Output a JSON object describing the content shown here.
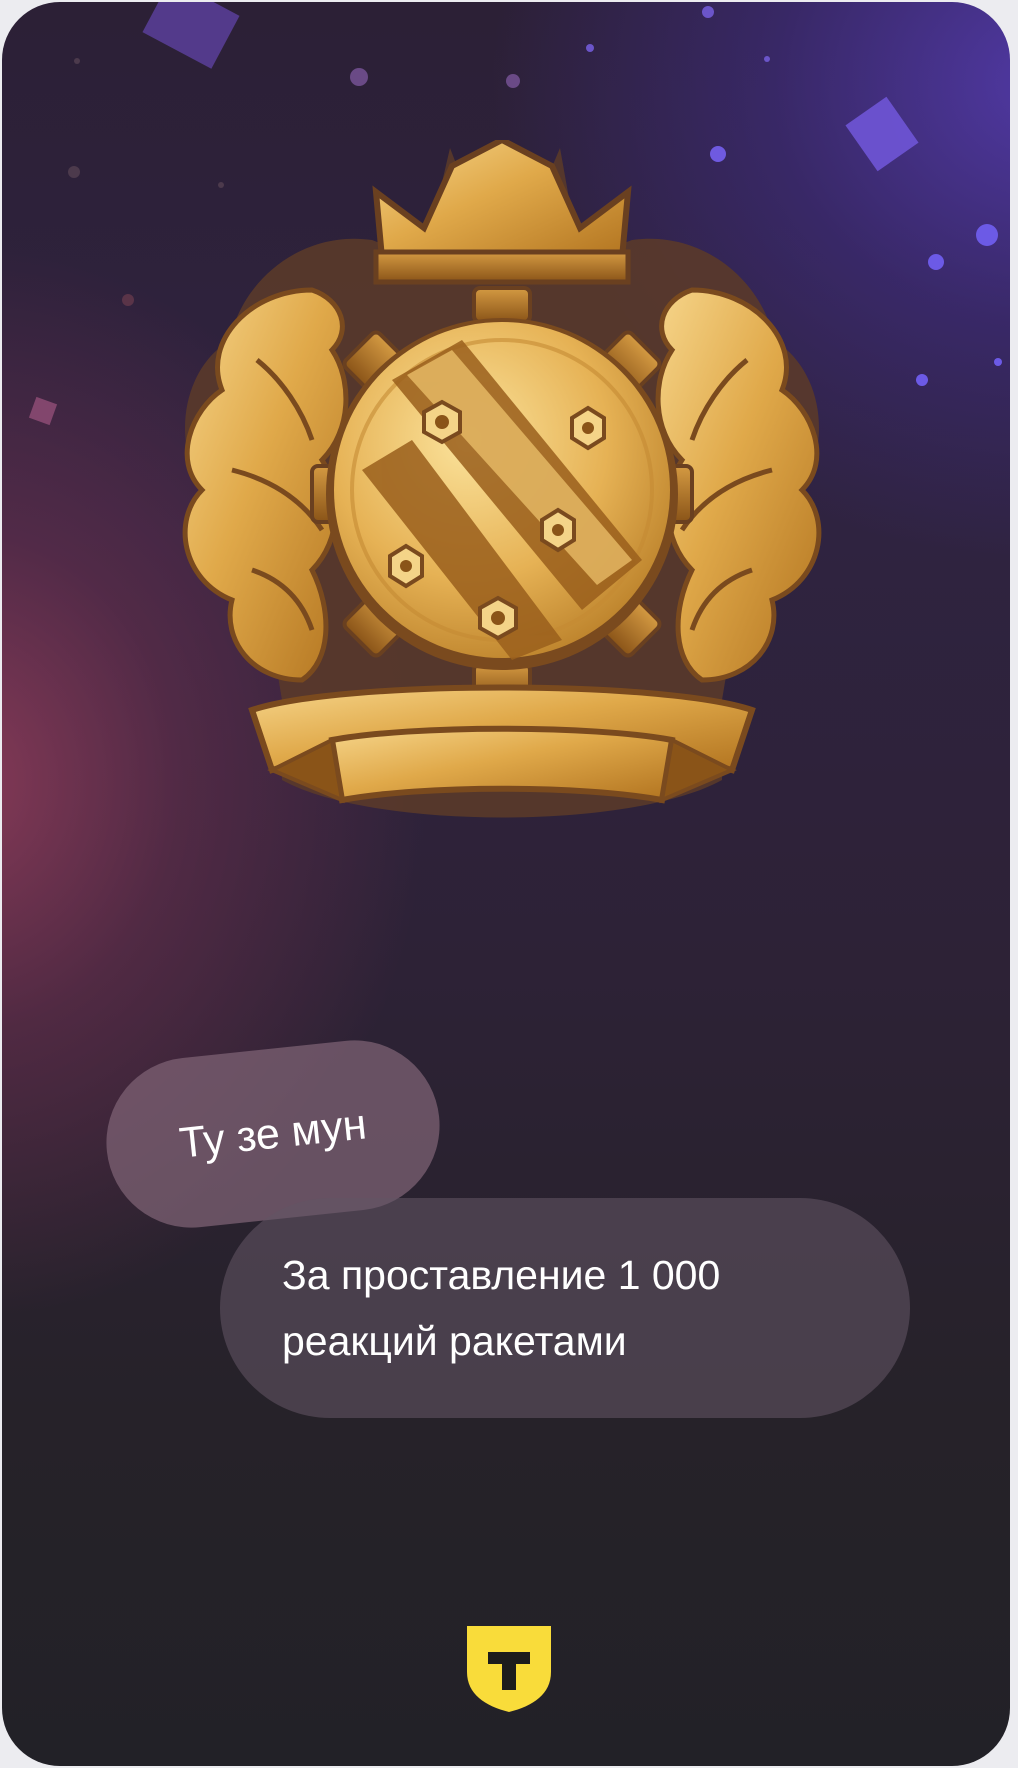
{
  "achievement": {
    "title": "Ту зе мун",
    "description_line1": "За проставление 1 000",
    "description_line2": "реакций ракетами"
  },
  "icons": {
    "badge": "gold-crest-medal-icon",
    "brand": "t-shield-logo-icon"
  },
  "colors": {
    "gold": "#e0a94a",
    "brand_yellow": "#f9dc3a",
    "pill_text": "#ffffff"
  }
}
